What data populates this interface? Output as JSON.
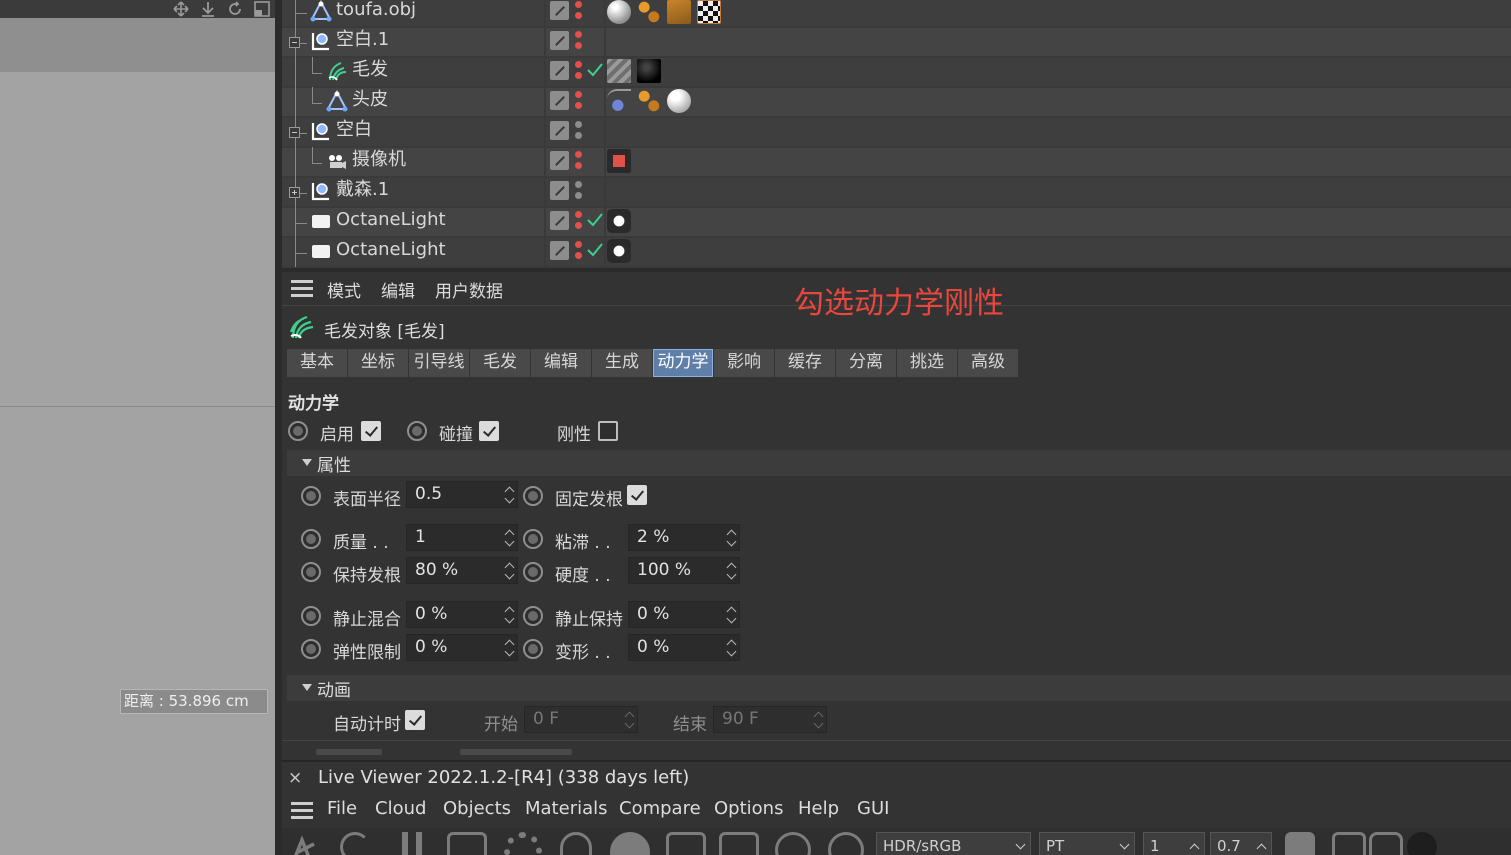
{
  "viewport": {
    "distance_readout": "距离 : 53.896 cm",
    "toolbar_icons": [
      "move-icon",
      "down-arrow-icon",
      "rotate-icon",
      "layout-icon"
    ]
  },
  "objects": [
    {
      "name": "toufa.obj",
      "icon": "polygon-object-icon",
      "level": 1,
      "expander": "none",
      "dots": "red",
      "check": false,
      "tags": [
        "sphere-material-tag",
        "dots-tag",
        "hair-render-tag",
        "checker-tag"
      ]
    },
    {
      "name": "空白.1",
      "icon": "null-object-icon",
      "level": 0,
      "expander": "minus",
      "dots": "red",
      "check": false,
      "tags": []
    },
    {
      "name": "毛发",
      "icon": "hair-object-icon",
      "level": 2,
      "expander": "none",
      "dots": "red",
      "check": true,
      "tags": [
        "hatched-tag",
        "black-sphere-tag"
      ]
    },
    {
      "name": "头皮",
      "icon": "polygon-object-icon",
      "level": 2,
      "expander": "none",
      "dots": "red",
      "check": false,
      "tags": [
        "spline-tag",
        "dots-tag",
        "white-sphere-tag"
      ]
    },
    {
      "name": "空白",
      "icon": "null-object-icon",
      "level": 0,
      "expander": "minus",
      "dots": "grey",
      "check": false,
      "tags": []
    },
    {
      "name": "摄像机",
      "icon": "camera-object-icon",
      "level": 2,
      "expander": "none",
      "dots": "red",
      "check": false,
      "tags": [
        "octane-camera-tag"
      ]
    },
    {
      "name": "戴森.1",
      "icon": "null-object-icon",
      "level": 0,
      "expander": "plus",
      "dots": "grey",
      "check": false,
      "tags": []
    },
    {
      "name": "OctaneLight",
      "icon": "octane-light-icon",
      "level": 0,
      "expander": "none",
      "dots": "red",
      "check": true,
      "tags": [
        "light-tag"
      ]
    },
    {
      "name": "OctaneLight",
      "icon": "octane-light-icon",
      "level": 0,
      "expander": "none",
      "dots": "red",
      "check": true,
      "tags": [
        "light-tag"
      ]
    }
  ],
  "attr": {
    "menu": [
      "模式",
      "编辑",
      "用户数据"
    ],
    "annotation": "勾选动力学刚性",
    "object_title": "毛发对象 [毛发]",
    "tabs": [
      "基本",
      "坐标",
      "引导线",
      "毛发",
      "编辑",
      "生成",
      "动力学",
      "影响",
      "缓存",
      "分离",
      "挑选",
      "高级"
    ],
    "active_tab": "动力学",
    "section": "动力学",
    "enable_label": "启用",
    "enable_checked": true,
    "collision_label": "碰撞",
    "collision_checked": true,
    "rigid_label": "刚性",
    "rigid_checked": false,
    "group_props": "属性",
    "surface_radius_label": "表面半径",
    "surface_radius_value": "0.5",
    "fix_root_label": "固定发根",
    "fix_root_checked": true,
    "mass_label": "质量 . .",
    "mass_value": "1",
    "drag_label": "粘滞 . .",
    "drag_value": "2 %",
    "hold_root_label": "保持发根",
    "hold_root_value": "80 %",
    "stiffness_label": "硬度 . .",
    "stiffness_value": "100 %",
    "rest_mix_label": "静止混合",
    "rest_mix_value": "0 %",
    "rest_hold_label": "静止保持",
    "rest_hold_value": "0 %",
    "elastic_limit_label": "弹性限制",
    "elastic_limit_value": "0 %",
    "deform_label": "变形 . .",
    "deform_value": "0 %",
    "group_anim": "动画",
    "auto_time_label": "自动计时",
    "auto_time_checked": true,
    "start_label": "开始",
    "start_value": "0 F",
    "end_label": "结束",
    "end_value": "90 F"
  },
  "live_viewer": {
    "close": "×",
    "title": "Live Viewer 2022.1.2-[R4] (338 days left)",
    "menu": [
      "File",
      "Cloud",
      "Objects",
      "Materials",
      "Compare",
      "Options",
      "Help",
      "GUI"
    ],
    "color_mode": "HDR/sRGB",
    "kernel": "PT",
    "value1": "1",
    "value2": "0.7"
  },
  "colors": {
    "accent_tab": "#5f7fa8",
    "annotation_red": "#e8473e",
    "dot_red": "#e2504a",
    "check_green": "#3fcf8e"
  }
}
